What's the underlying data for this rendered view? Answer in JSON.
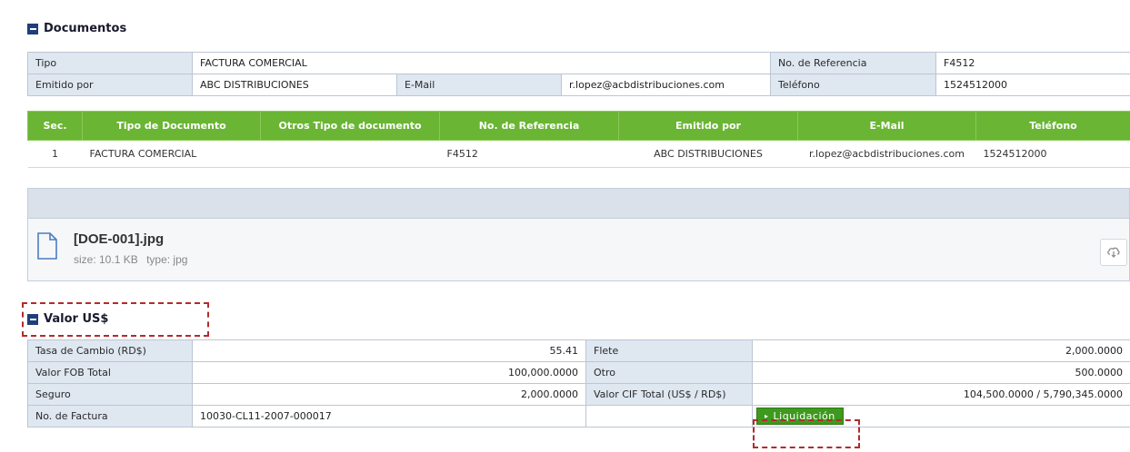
{
  "documentos": {
    "title": "Documentos",
    "tipo_label": "Tipo",
    "tipo_value": "FACTURA COMERCIAL",
    "ref_label": "No. de Referencia",
    "ref_value": "F4512",
    "emitido_label": "Emitido por",
    "emitido_value": "ABC DISTRIBUCIONES",
    "email_label": "E-Mail",
    "email_value": "r.lopez@acbdistribuciones.com",
    "telefono_label": "Teléfono",
    "telefono_value": "1524512000"
  },
  "grid": {
    "headers": [
      "Sec.",
      "Tipo de Documento",
      "Otros Tipo de documento",
      "No. de Referencia",
      "Emitido por",
      "E-Mail",
      "Teléfono"
    ],
    "rows": [
      [
        "1",
        "FACTURA COMERCIAL",
        "",
        "F4512",
        "ABC DISTRIBUCIONES",
        "r.lopez@acbdistribuciones.com",
        "1524512000"
      ]
    ]
  },
  "attachment": {
    "file_name": "[DOE-001].jpg",
    "size_label": "size: 10.1 KB",
    "type_label": "type: jpg",
    "icon": "file-icon",
    "download_icon": "cloud-download-icon"
  },
  "valor": {
    "title": "Valor US$",
    "tasa_label": "Tasa de Cambio (RD$)",
    "tasa_value": "55.41",
    "flete_label": "Flete",
    "flete_value": "2,000.0000",
    "fob_label": "Valor FOB Total",
    "fob_value": "100,000.0000",
    "otro_label": "Otro",
    "otro_value": "500.0000",
    "seguro_label": "Seguro",
    "seguro_value": "2,000.0000",
    "cif_label": "Valor CIF Total (US$ / RD$)",
    "cif_value": "104,500.0000 / 5,790,345.0000",
    "factura_label": "No. de Factura",
    "factura_value": "10030-CL11-2007-000017",
    "liquidacion_label": "Liquidación"
  },
  "colors": {
    "header_green": "#6ab533",
    "label_bg": "#dfe7f1",
    "toggle_blue": "#1f3e7a",
    "highlight_red": "#b52a2a",
    "button_green": "#3e9a1e"
  }
}
